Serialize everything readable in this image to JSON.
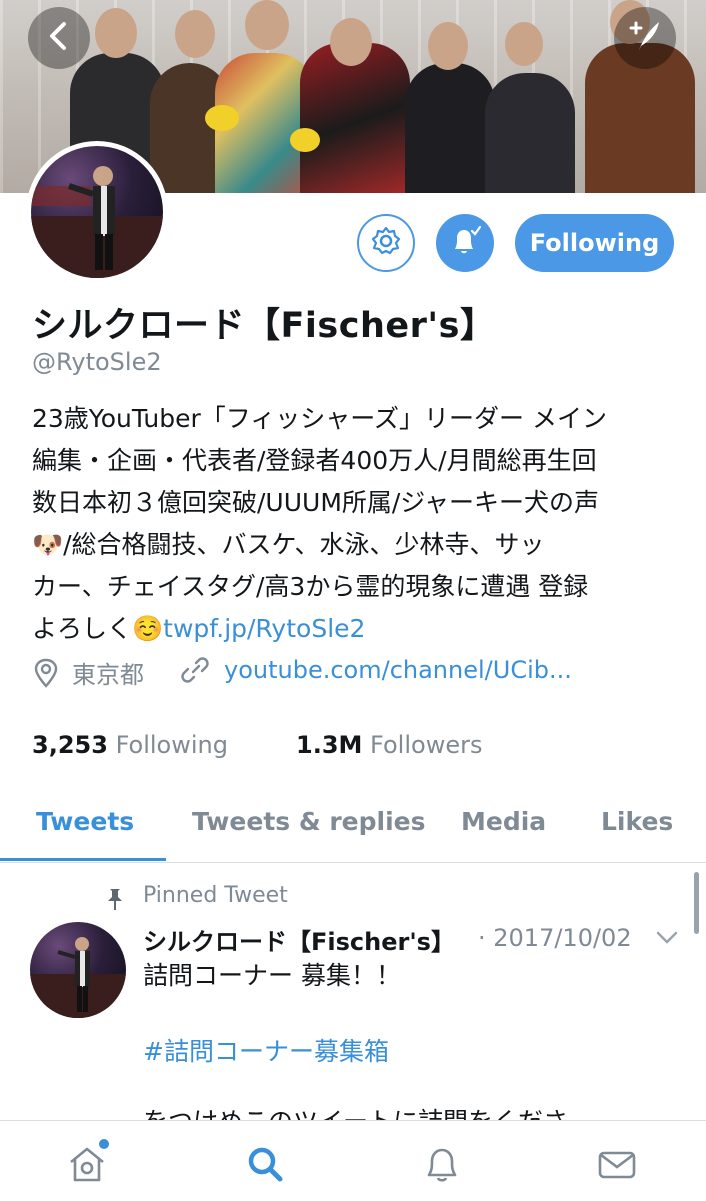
{
  "profile": {
    "name": "シルクロード【Fischer's】",
    "handle": "@RytoSle2",
    "bio_lines": [
      "23歳YouTuber「フィッシャーズ」リーダー メイン",
      "編集・企画・代表者/登録者400万人/月間総再生回",
      "数日本初３億回突破/UUUM所属/ジャーキー犬の声",
      "🐶/総合格闘技、バスケ、水泳、少林寺、サッ",
      "カー、チェイスタグ/高3から霊的現象に遭遇 登録"
    ],
    "bio_last_text": "よろしく☺️",
    "bio_link": "twpf.jp/RytoSle2",
    "location": "東京都",
    "website": "youtube.com/channel/UCib...",
    "following_count": "3,253",
    "following_label": "Following",
    "followers_count": "1.3M",
    "followers_label": "Followers",
    "follow_button_label": "Following"
  },
  "tabs": [
    {
      "label": "Tweets",
      "active": true
    },
    {
      "label": "Tweets & replies",
      "active": false
    },
    {
      "label": "Media",
      "active": false
    },
    {
      "label": "Likes",
      "active": false
    }
  ],
  "pinned_tweet": {
    "pinned_label": "Pinned Tweet",
    "author": "シルクロード【Fischer's】",
    "date": "· 2017/10/02",
    "text": "詰問コーナー 募集！！",
    "hashtag": "#詰問コーナー募集箱",
    "text_more": "をつけめこのツイートに詰問をくださ"
  },
  "icons": {
    "back": "back-arrow-icon",
    "compose": "compose-icon",
    "settings": "gear-icon",
    "notifications": "bell-check-icon",
    "location": "location-pin-icon",
    "link": "link-icon",
    "pin": "pin-icon",
    "caret": "chevron-down-icon",
    "nav": [
      "home-icon",
      "search-icon",
      "notifications-icon",
      "messages-icon"
    ]
  },
  "colors": {
    "accent": "#3a8fd9",
    "button_fill": "#4a98e6",
    "secondary_text": "#7f8a94"
  }
}
